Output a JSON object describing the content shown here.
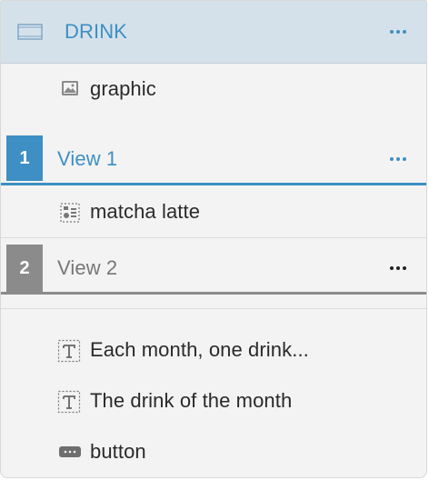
{
  "header": {
    "label": "DRINK",
    "icon": "frame-icon",
    "more_icon": "more-dots-icon"
  },
  "layers": {
    "graphic": {
      "label": "graphic",
      "icon": "image-icon"
    },
    "view1": {
      "badge": "1",
      "label": "View 1",
      "more_icon": "more-dots-icon"
    },
    "matcha": {
      "label": "matcha latte",
      "icon": "component-icon"
    },
    "view2": {
      "badge": "2",
      "label": "View 2",
      "more_icon": "more-dots-icon"
    },
    "text1": {
      "label": "Each month, one drink...",
      "icon": "text-icon"
    },
    "text2": {
      "label": "The drink of the month",
      "icon": "text-icon"
    },
    "button": {
      "label": "button",
      "icon": "button-icon"
    }
  },
  "colors": {
    "accent": "#3d8fc4",
    "header_bg": "#d5e1ea",
    "muted": "#8b8b8b",
    "panel_bg": "#f3f3f3"
  }
}
